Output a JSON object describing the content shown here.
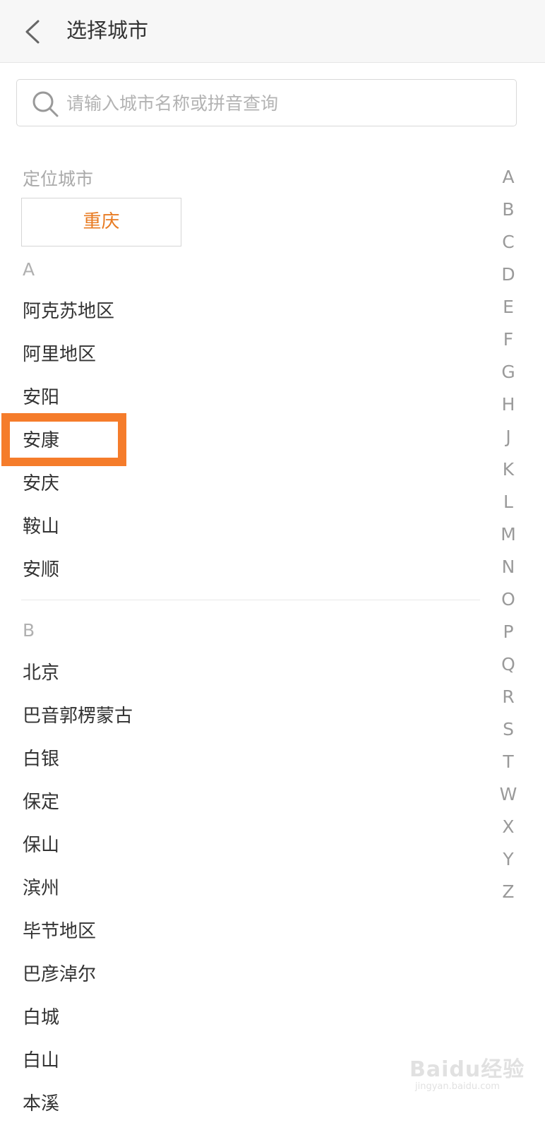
{
  "header": {
    "title": "选择城市",
    "back_icon": "chevron-left-icon"
  },
  "search": {
    "placeholder": "请输入城市名称或拼音查询",
    "icon": "search-icon"
  },
  "located": {
    "label": "定位城市",
    "city": "重庆"
  },
  "sections": [
    {
      "letter": "A",
      "cities": [
        "阿克苏地区",
        "阿里地区",
        "安阳",
        "安康",
        "安庆",
        "鞍山",
        "安顺"
      ]
    },
    {
      "letter": "B",
      "cities": [
        "北京",
        "巴音郭楞蒙古",
        "白银",
        "保定",
        "保山",
        "滨州",
        "毕节地区",
        "巴彦淖尔",
        "白城",
        "白山",
        "本溪"
      ]
    }
  ],
  "highlighted_city": "安康",
  "index_letters": [
    "A",
    "B",
    "C",
    "D",
    "E",
    "F",
    "G",
    "H",
    "J",
    "K",
    "L",
    "M",
    "N",
    "O",
    "P",
    "Q",
    "R",
    "S",
    "T",
    "W",
    "X",
    "Y",
    "Z"
  ],
  "colors": {
    "accent": "#e87b22",
    "highlight_border": "#f57c2b",
    "header_bg": "#f7f7f7"
  },
  "watermark": {
    "text": "Baidu经验",
    "sub": "jingyan.baidu.com"
  }
}
